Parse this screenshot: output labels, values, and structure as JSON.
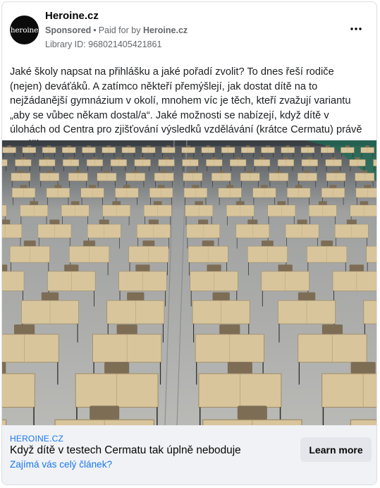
{
  "post": {
    "page_name": "Heroine.cz",
    "avatar_text": "heroine",
    "sponsored": "Sponsored",
    "paid_for_by": "Paid for by",
    "paid_for_by_name": "Heroine.cz",
    "library_id": "Library ID: 968021405421861",
    "more_icon": "ellipsis-icon",
    "body": "Jaké školy napsat na přihlášku a jaké pořadí zvolit? To dnes řeší rodiče (nejen) deváťáků. A zatímco někteří přemýšlejí, jak dostat dítě na to nejžádanější gymnázium v okolí, mnohem víc je těch, kteří zvažují variantu „aby se vůbec někam dostal/a“. Jaké možnosti se nabízejí, když dítě v úlohách od Centra pro zjišťování výsledků vzdělávání (krátce Cermatu) právě nezáří?"
  },
  "link": {
    "domain": "HEROINE.CZ",
    "headline": "Když dítě v testech Cermatu tak úplně neboduje",
    "subline": "Zajímá vás celý článek?",
    "cta": "Learn more"
  },
  "colors": {
    "accent": "#1877f2",
    "muted": "#65676b",
    "footer_bg": "#f0f2f5"
  }
}
